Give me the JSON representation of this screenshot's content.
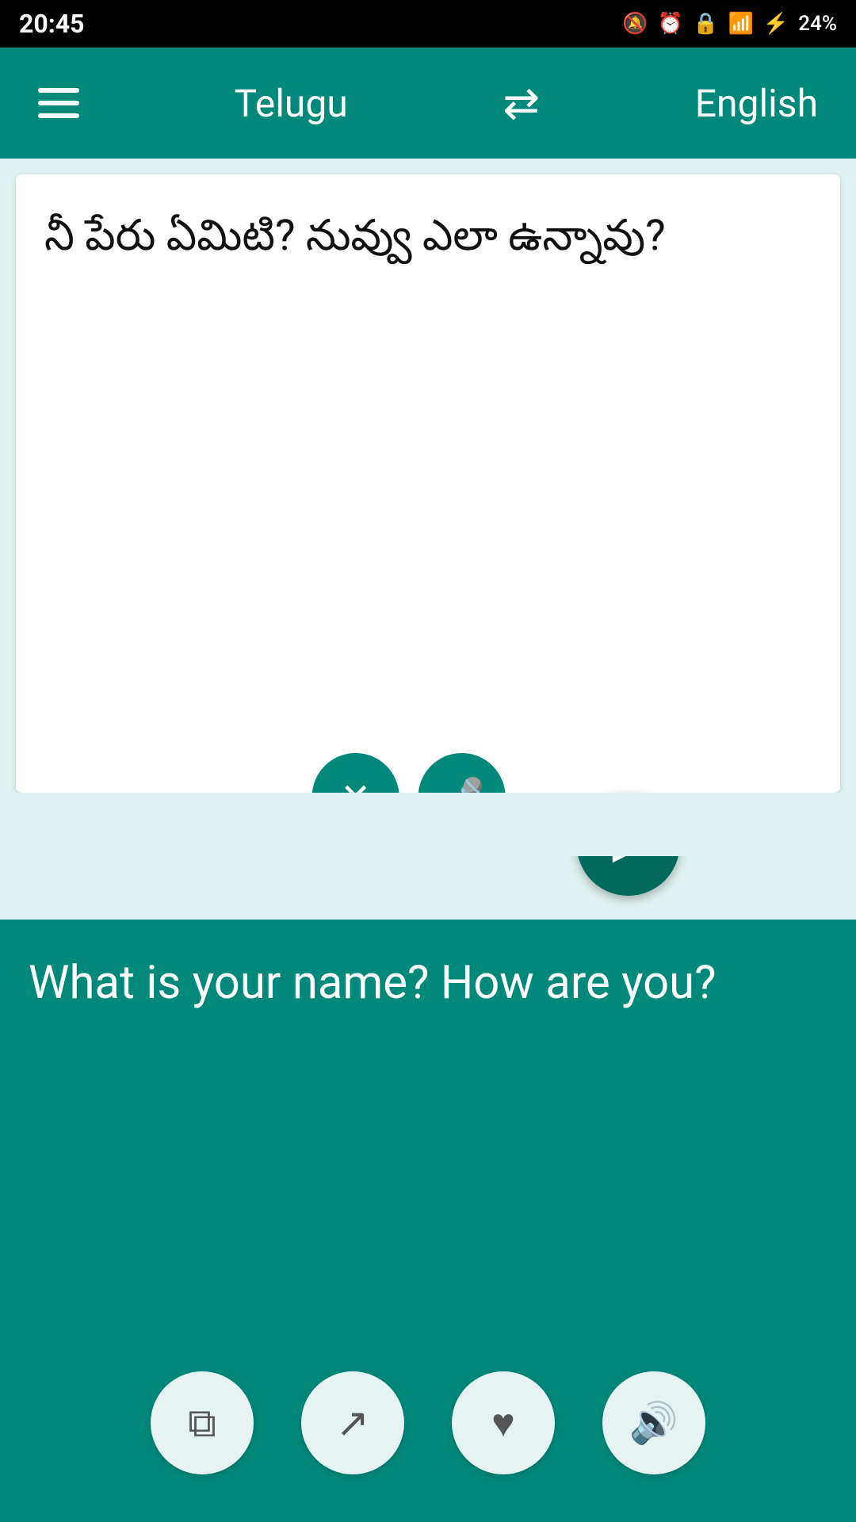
{
  "status_bar": {
    "time": "20:45",
    "battery": "24%"
  },
  "app_bar": {
    "menu_label": "Menu",
    "source_lang": "Telugu",
    "swap_label": "Swap languages",
    "target_lang": "English"
  },
  "source": {
    "text": "నీ పేరు ఏమిటి? నువ్వు ఎలా ఉన్నావు?",
    "clear_label": "Clear",
    "mic_label": "Microphone"
  },
  "translation": {
    "text": "What is your name? How are you?",
    "send_label": "Send",
    "copy_label": "Copy",
    "share_label": "Share",
    "favorite_label": "Favorite",
    "speaker_label": "Speaker"
  }
}
